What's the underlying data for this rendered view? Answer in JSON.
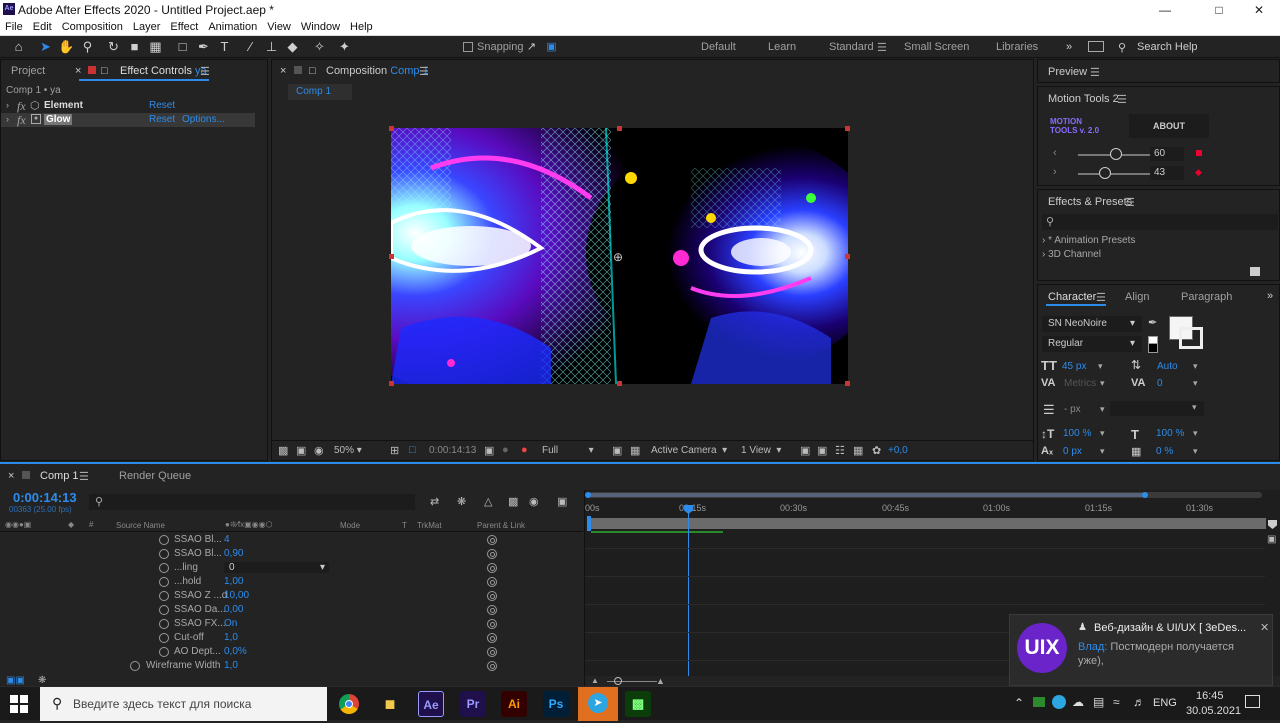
{
  "window": {
    "title": "Adobe After Effects 2020 - Untitled Project.aep *"
  },
  "menu": [
    "File",
    "Edit",
    "Composition",
    "Layer",
    "Effect",
    "Animation",
    "View",
    "Window",
    "Help"
  ],
  "toolbar": {
    "snapping": "Snapping"
  },
  "workspaces": {
    "default": "Default",
    "learn": "Learn",
    "standard": "Standard",
    "small_screen": "Small Screen",
    "libraries": "Libraries",
    "search_help": "Search Help"
  },
  "left_panel": {
    "tab_project": "Project",
    "tab_effect_controls": "Effect Controls",
    "tab_effect_controls_layer": "ya",
    "breadcrumb": "Comp 1 • ya",
    "effects": [
      {
        "fx": "fx",
        "name": "Element",
        "reset": "Reset",
        "options": ""
      },
      {
        "fx": "fx",
        "name": "Glow",
        "reset": "Reset",
        "options": "Options..."
      }
    ]
  },
  "composition": {
    "tab_label": "Composition",
    "tab_comp": "Comp 1",
    "sub_tab": "Comp 1",
    "zoom": "50%",
    "timecode": "0:00:14:13",
    "resolution": "Full",
    "camera": "Active Camera",
    "view": "1 View",
    "exposure": "+0,0"
  },
  "right_panel": {
    "preview": "Preview",
    "motion_tools": "Motion Tools 2",
    "mt_logo_line1": "MOTION",
    "mt_logo_line2": "TOOLS v. 2.0",
    "mt_about": "ABOUT",
    "mt_slider1_value": "60",
    "mt_slider2_value": "43",
    "effects_presets": "Effects & Presets",
    "presets": [
      "* Animation Presets",
      "3D Channel"
    ],
    "character_tab": "Character",
    "align_tab": "Align",
    "paragraph_tab": "Paragraph",
    "font": "SN NeoNoire",
    "style": "Regular",
    "font_size": "45 px",
    "leading": "Auto",
    "kerning": "Metrics",
    "tracking": "0",
    "stroke_unit": "- px",
    "vscale": "100 %",
    "hscale": "100 %",
    "baseline": "0 px",
    "tsume": "0 %"
  },
  "timeline": {
    "tab_comp": "Comp 1",
    "tab_render": "Render Queue",
    "timecode": "0:00:14:13",
    "frame_info": "00363 (25.00 fps)",
    "col_source": "Source Name",
    "col_mode": "Mode",
    "col_t": "T",
    "col_trkmat": "TrkMat",
    "col_parent": "Parent & Link",
    "ruler": [
      "00s",
      "00:15s",
      "00:30s",
      "00:45s",
      "01:00s",
      "01:15s",
      "01:30s"
    ],
    "properties": [
      {
        "name": "SSAO Bl...",
        "value": "4"
      },
      {
        "name": "SSAO Bl...",
        "value": "0,90"
      },
      {
        "name": "...ling",
        "value": "0"
      },
      {
        "name": "...hold",
        "value": "1,00"
      },
      {
        "name": "SSAO Z ...d",
        "value": "10,00"
      },
      {
        "name": "SSAO Da...",
        "value": "0,00"
      },
      {
        "name": "SSAO FX...",
        "value": "On"
      },
      {
        "name": "Cut-off",
        "value": "1,0"
      },
      {
        "name": "AO Dept...",
        "value": "0,0%"
      },
      {
        "name": "Wireframe Width",
        "value": "1,0"
      }
    ]
  },
  "notification": {
    "avatar": "UIX",
    "title": "Веб-дизайн & UI/UX [ 3eDes...",
    "sender": "Влад:",
    "message": "Постмодерн получается уже),"
  },
  "taskbar": {
    "search_placeholder": "Введите здесь текст для поиска",
    "apps": [
      "Ae",
      "Pr",
      "Ai",
      "Ps"
    ],
    "lang": "ENG",
    "time": "16:45",
    "date": "30.05.2021"
  }
}
